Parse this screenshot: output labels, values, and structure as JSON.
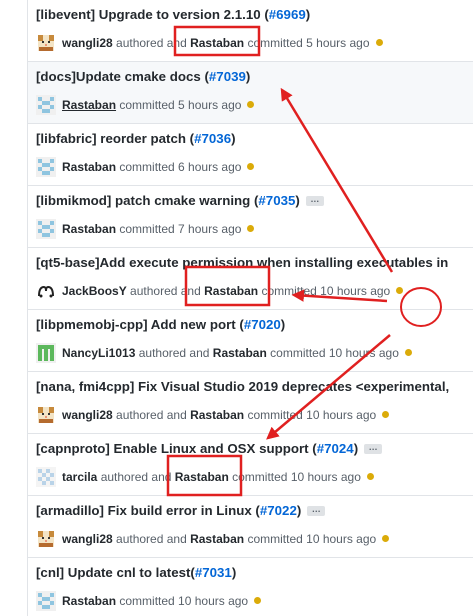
{
  "commits": [
    {
      "prefix": "[libevent] Upgrade to version 2.1.10 (",
      "number": "#6969",
      "suffix": ")",
      "ellipsis": false,
      "avatar": "cat-avatar",
      "author": "wangli28",
      "authored": " authored and ",
      "committer": "Rastaban",
      "committed": " committed 5 hours ago"
    },
    {
      "prefix": "[docs]Update cmake docs (",
      "number": "#7039",
      "suffix": ")",
      "ellipsis": false,
      "avatar": "pixel-avatar-blue",
      "author": "",
      "authored": "",
      "committer": "Rastaban",
      "committed": " committed 5 hours ago"
    },
    {
      "prefix": "[libfabric] reorder patch (",
      "number": "#7036",
      "suffix": ")",
      "ellipsis": false,
      "avatar": "pixel-avatar-blue",
      "author": "",
      "authored": "",
      "committer": "Rastaban",
      "committed": " committed 6 hours ago"
    },
    {
      "prefix": "[libmikmod] patch cmake warning (",
      "number": "#7035",
      "suffix": ")",
      "ellipsis": true,
      "avatar": "pixel-avatar-blue",
      "author": "",
      "authored": "",
      "committer": "Rastaban",
      "committed": " committed 7 hours ago"
    },
    {
      "prefix": "[qt5-base]Add execute permission when installing executables in",
      "number": "",
      "suffix": "",
      "ellipsis": false,
      "avatar": "glyph-avatar",
      "author": "JackBoosY",
      "authored": " authored and ",
      "committer": "Rastaban",
      "committed": " committed 10 hours ago"
    },
    {
      "prefix": "[libpmemobj-cpp] Add new port (",
      "number": "#7020",
      "suffix": ")",
      "ellipsis": false,
      "avatar": "pixel-avatar-green",
      "author": "NancyLi1013",
      "authored": " authored and ",
      "committer": "Rastaban",
      "committed": " committed 10 hours ago"
    },
    {
      "prefix": "[nana, fmi4cpp] Fix Visual Studio 2019 deprecates <experimental,",
      "number": "",
      "suffix": "",
      "ellipsis": false,
      "avatar": "cat-avatar",
      "author": "wangli28",
      "authored": " authored and ",
      "committer": "Rastaban",
      "committed": " committed 10 hours ago"
    },
    {
      "prefix": "[capnproto] Enable Linux and OSX support (",
      "number": "#7024",
      "suffix": ")",
      "ellipsis": true,
      "avatar": "pixel-avatar-light",
      "author": "tarcila",
      "authored": " authored and ",
      "committer": "Rastaban",
      "committed": " committed 10 hours ago"
    },
    {
      "prefix": "[armadillo] Fix build error in Linux (",
      "number": "#7022",
      "suffix": ")",
      "ellipsis": true,
      "avatar": "cat-avatar",
      "author": "wangli28",
      "authored": " authored and ",
      "committer": "Rastaban",
      "committed": " committed 10 hours ago"
    },
    {
      "prefix": "[cnl] Update cnl to latest(",
      "number": "#7031",
      "suffix": ")",
      "ellipsis": false,
      "avatar": "pixel-avatar-blue",
      "author": "",
      "authored": "",
      "committer": "Rastaban",
      "committed": " committed 10 hours ago"
    }
  ],
  "colors": {
    "link": "#0366d6",
    "status_dot": "#dbab09",
    "annotation": "#e02020"
  },
  "ellipsis_label": "…"
}
